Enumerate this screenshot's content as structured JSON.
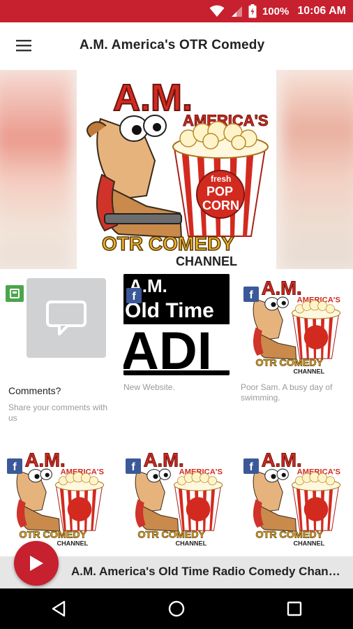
{
  "status_bar": {
    "battery_percent": "100%",
    "time": "10:06 AM",
    "icons": [
      "wifi-icon",
      "signal-icon",
      "battery-icon"
    ]
  },
  "app_bar": {
    "title": "A.M. America's OTR Comedy",
    "menu_icon": "hamburger-menu-icon"
  },
  "hero": {
    "logo_lines": [
      "A.M.",
      "AMERICA'S",
      "OTR COMEDY",
      "CHANNEL"
    ],
    "popcorn_text": [
      "fresh",
      "POP",
      "CORN"
    ]
  },
  "tiles": [
    {
      "title": "Comments?",
      "text": "Share your comments with us",
      "icon": "comment-bubble-icon",
      "badge": "message-badge-icon"
    },
    {
      "title": "",
      "text": "New Website.",
      "thumb_text": [
        "A.M.",
        "Old Time",
        "ADI"
      ],
      "badge": "facebook-icon",
      "badge_letter": "f"
    },
    {
      "title": "",
      "text": "Poor Sam. A busy day of swimming.",
      "badge": "facebook-icon",
      "badge_letter": "f"
    },
    {
      "badge": "facebook-icon",
      "badge_letter": "f"
    },
    {
      "badge": "facebook-icon",
      "badge_letter": "f"
    },
    {
      "badge": "facebook-icon",
      "badge_letter": "f"
    }
  ],
  "player": {
    "now_playing": "A.M. America's Old Time Radio Comedy Channel",
    "play_icon": "play-icon"
  },
  "nav": {
    "back": "back-icon",
    "home": "home-icon",
    "recents": "recents-icon"
  },
  "colors": {
    "brand_red": "#c7202f",
    "facebook_blue": "#3b5998",
    "player_bg": "#e6e6e6"
  }
}
